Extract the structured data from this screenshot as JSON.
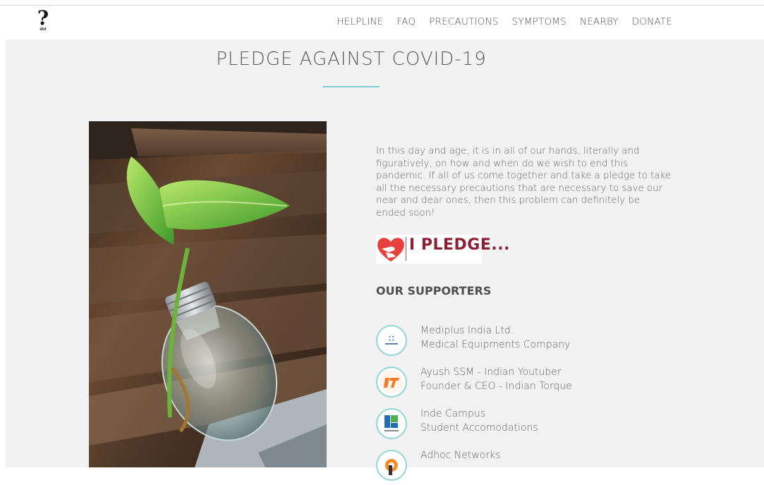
{
  "header": {
    "logo_text": "dot",
    "nav": [
      "HELPLINE",
      "FAQ",
      "PRECAUTIONS",
      "SYMPTOMS",
      "NEARBY",
      "DONATE"
    ]
  },
  "main": {
    "title": "PLEDGE AGAINST COVID-19",
    "intro": "In this day and age, it is in all of our hands, literally and figuratively, on how and when do we wish to end this pandemic. If all of us come together and take a pledge to take all the necessary precautions that are necessary to save our near and dear ones, then this problem can definitely be ended soon!",
    "pledge_label": "I PLEDGE...",
    "supporters_heading": "OUR SUPPORTERS",
    "supporters": [
      {
        "name": "Mediplus India Ltd.",
        "desc": "Medical Equipments Company",
        "icon": "mediplus-logo-icon"
      },
      {
        "name": "Ayush SSM - Indian Youtuber",
        "desc": "Founder & CEO - Indian Torque",
        "icon": "indian-torque-logo-icon"
      },
      {
        "name": "Inde Campus",
        "desc": "Student Accomodations",
        "icon": "inde-campus-logo-icon"
      },
      {
        "name": "Adhoc Networks",
        "desc": "",
        "icon": "adhoc-networks-logo-icon"
      }
    ]
  },
  "colors": {
    "accent": "#7fcccd",
    "background": "#f2f2f2",
    "pledge_red": "#8b2035",
    "heart_red": "#e8403c"
  }
}
